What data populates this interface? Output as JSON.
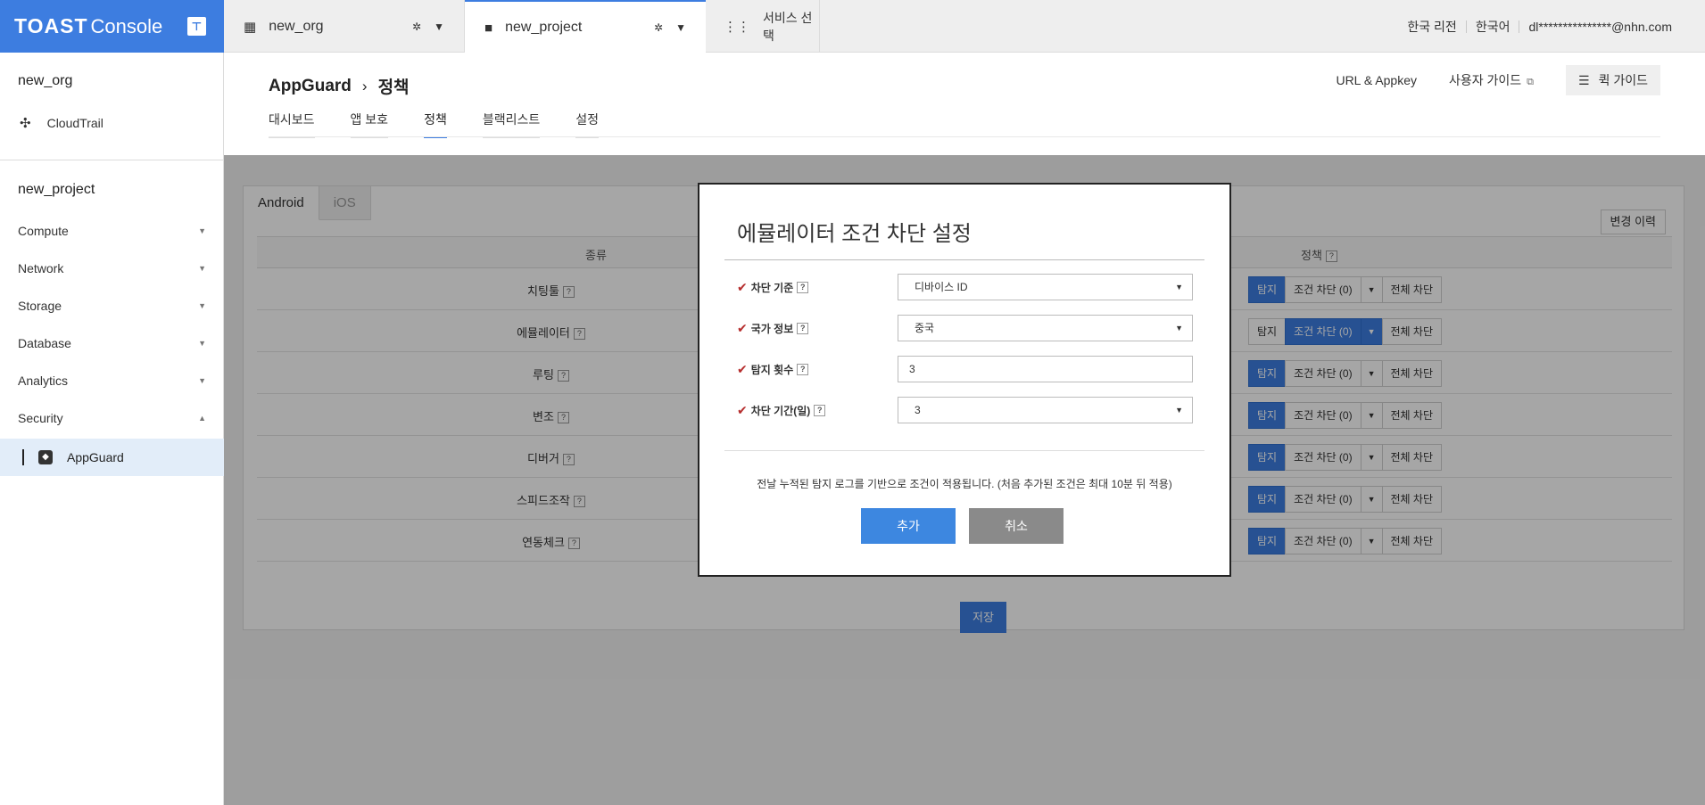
{
  "brand": {
    "logo": "TOAST",
    "sub": "Console"
  },
  "topbar": {
    "org_tab": "new_org",
    "project_tab": "new_project",
    "service_tab": "서비스 선택",
    "region": "한국 리전",
    "language": "한국어",
    "user": "dl***************@nhn.com"
  },
  "sidebar": {
    "org": "new_org",
    "cloudtrail": "CloudTrail",
    "project": "new_project",
    "categories": [
      "Compute",
      "Network",
      "Storage",
      "Database",
      "Analytics",
      "Security"
    ],
    "active_item": "AppGuard"
  },
  "header": {
    "service": "AppGuard",
    "page": "정책",
    "url_appkey": "URL & Appkey",
    "user_guide": "사용자 가이드",
    "quick_guide": "퀵 가이드",
    "tabs": [
      "대시보드",
      "앱 보호",
      "정책",
      "블랙리스트",
      "설정"
    ]
  },
  "policy": {
    "os_tabs": [
      "Android",
      "iOS"
    ],
    "history": "변경 이력",
    "col_type": "종류",
    "col_policy": "정책",
    "rows": [
      {
        "name": "치팅툴",
        "detect": "탐지",
        "cond": "조건 차단 (0)",
        "all": "전체 차단"
      },
      {
        "name": "에뮬레이터",
        "detect": "탐지",
        "cond": "조건 차단 (0)",
        "all": "전체 차단"
      },
      {
        "name": "루팅",
        "detect": "탐지",
        "cond": "조건 차단 (0)",
        "all": "전체 차단"
      },
      {
        "name": "변조",
        "detect": "탐지",
        "cond": "조건 차단 (0)",
        "all": "전체 차단"
      },
      {
        "name": "디버거",
        "detect": "탐지",
        "cond": "조건 차단 (0)",
        "all": "전체 차단"
      },
      {
        "name": "스피드조작",
        "detect": "탐지",
        "cond": "조건 차단 (0)",
        "all": "전체 차단"
      },
      {
        "name": "연동체크",
        "detect": "탐지",
        "cond": "조건 차단 (0)",
        "all": "전체 차단"
      }
    ],
    "save": "저장"
  },
  "modal": {
    "title": "에뮬레이터 조건 차단 설정",
    "fields": [
      {
        "label": "차단 기준",
        "value": "디바이스 ID"
      },
      {
        "label": "국가 정보",
        "value": "중국"
      },
      {
        "label": "탐지 횟수",
        "value": "3"
      },
      {
        "label": "차단 기간(일)",
        "value": "3"
      }
    ],
    "note": "전날 누적된 탐지 로그를 기반으로 조건이 적용됩니다. (처음 추가된 조건은 최대 10분 뒤 적용)",
    "add": "추가",
    "cancel": "취소"
  },
  "colors": {
    "accent": "#3d7de0",
    "check": "#b52d2d"
  }
}
